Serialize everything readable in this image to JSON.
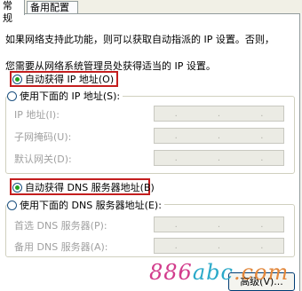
{
  "tabs": [
    {
      "label": "常规"
    },
    {
      "label": "备用配置"
    }
  ],
  "intro": {
    "line1": "如果网络支持此功能，则可以获取自动指派的 IP 设置。否则，",
    "line2": "您需要从网络系统管理员处获得适当的 IP 设置。"
  },
  "ip_section": {
    "auto_label": "自动获得 IP 地址(O)",
    "manual_label": "使用下面的 IP 地址(S):",
    "fields": [
      {
        "label": "IP 地址(I):"
      },
      {
        "label": "子网掩码(U):"
      },
      {
        "label": "默认网关(D):"
      }
    ]
  },
  "dns_section": {
    "auto_label": "自动获得 DNS 服务器地址(B)",
    "manual_label": "使用下面的 DNS 服务器地址(E):",
    "fields": [
      {
        "label": "首选 DNS 服务器(P):"
      },
      {
        "label": "备用 DNS 服务器(A):"
      }
    ]
  },
  "buttons": {
    "advanced": "高级(V)..."
  },
  "watermark": {
    "part1": "886",
    "part2": "abc",
    "part3": ".com"
  },
  "colors": {
    "highlight": "#c41e1e",
    "radio_dot": "#21a121",
    "disabled_text": "#a0a0a0"
  }
}
